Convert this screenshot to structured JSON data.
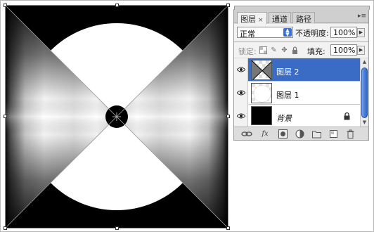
{
  "layers_panel": {
    "tabs": [
      {
        "label": "图层",
        "active": true,
        "close_glyph": "×"
      },
      {
        "label": "通道",
        "active": false
      },
      {
        "label": "路径",
        "active": false
      }
    ],
    "menu_icon": "panel-menu-icon",
    "blend_mode": "正常",
    "opacity_label": "不透明度:",
    "opacity_value": "100%",
    "lock_label": "锁定:",
    "fill_label": "填充:",
    "fill_value": "100%",
    "layers": [
      {
        "name": "图层 2",
        "selected": true,
        "visible": true,
        "thumbnail": "x-shape"
      },
      {
        "name": "图层 1",
        "selected": false,
        "visible": true,
        "thumbnail": "white-circle"
      },
      {
        "name": "背景",
        "selected": false,
        "visible": true,
        "thumbnail": "black",
        "locked": true
      }
    ],
    "footer_icons": [
      "link-icon",
      "fx-icon",
      "mask-icon",
      "adjustment-icon",
      "group-icon",
      "new-layer-icon",
      "trash-icon"
    ]
  },
  "colors": {
    "selection": "#3a6cc6",
    "scroll_thumb": "#3a6fd8",
    "panel_bg": "#dcdcdc"
  }
}
